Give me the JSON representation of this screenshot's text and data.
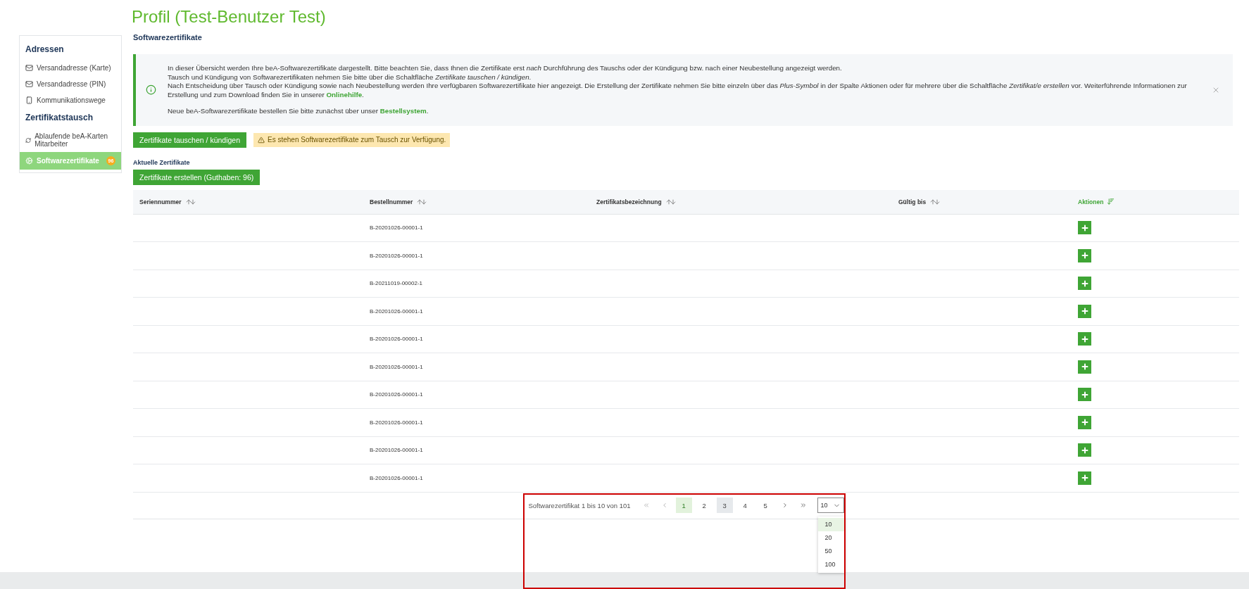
{
  "page_title": "Profil (Test-Benutzer Test)",
  "sidebar": {
    "sections": [
      {
        "heading": "Adressen",
        "items": [
          {
            "label": "Versandadresse (Karte)",
            "kind": "mail",
            "selected": false
          },
          {
            "label": "Versandadresse (PIN)",
            "kind": "mail",
            "selected": false
          },
          {
            "label": "Kommunikationswege",
            "kind": "phone",
            "selected": false
          }
        ]
      },
      {
        "heading": "Zertifikatstausch",
        "items": [
          {
            "label": "Ablaufende beA-Karten Mitarbeiter",
            "kind": "sync",
            "selected": false
          },
          {
            "label": "Softwarezertifikate",
            "kind": "gear",
            "selected": true,
            "badge": "96"
          }
        ]
      }
    ]
  },
  "section_title": "Softwarezertifikate",
  "info": {
    "blocks": [
      [
        {
          "text": "In dieser Übersicht werden Ihre beA-Softwarezertifikate dargestellt. Bitte beachten Sie, dass Ihnen die Zertifikate erst *nach* Durchführung des Tauschs oder der Kündigung bzw. nach einer Neubestellung angezeigt werden."
        },
        {
          "text": "Tausch und Kündigung von Softwarezertifikaten nehmen Sie bitte über die Schaltfläche *Zertifikate tauschen / kündigen*."
        },
        {
          "text": "Nach Entscheidung über Tausch oder Kündigung sowie nach Neubestellung werden Ihre verfügbaren Softwarezertifikate hier angezeigt. Die Erstellung der Zertifikate nehmen Sie bitte einzeln über das *Plus-Symbol* in der Spalte Aktionen oder für mehrere über die Schaltfläche *Zertifikat/e erstellen* vor. Weiterführende Informationen zur Erstellung und zum Download finden Sie in unserer",
          "link": "Onlinehilfe",
          "tail": "."
        }
      ],
      [
        {
          "text": "Neue beA-Softwarezertifikate bestellen Sie bitte zunächst über unser",
          "link": "Bestellsystem",
          "tail": "."
        }
      ]
    ]
  },
  "exchange_button": "Zertifikate tauschen / kündigen",
  "warning": "Es stehen Softwarezertifikate zum Tausch zur Verfügung.",
  "table_title": "Aktuelle Zertifikate",
  "create_button": "Zertifikate erstellen (Guthaben: 96)",
  "table": {
    "columns": [
      {
        "label": "Seriennummer",
        "active": false
      },
      {
        "label": "Bestellnummer",
        "active": false
      },
      {
        "label": "Zertifikatsbezeichnung",
        "active": false
      },
      {
        "label": "Gültig bis",
        "active": false
      },
      {
        "label": "Aktionen",
        "active": true
      }
    ],
    "rows": [
      {
        "order": "B-20201026-00001-1"
      },
      {
        "order": "B-20201026-00001-1"
      },
      {
        "order": "B-20211019-00002-1"
      },
      {
        "order": "B-20201026-00001-1"
      },
      {
        "order": "B-20201026-00001-1"
      },
      {
        "order": "B-20201026-00001-1"
      },
      {
        "order": "B-20201026-00001-1"
      },
      {
        "order": "B-20201026-00001-1"
      },
      {
        "order": "B-20201026-00001-1"
      },
      {
        "order": "B-20201026-00001-1"
      }
    ]
  },
  "pagination": {
    "summary": "Softwarezertifikat 1 bis 10 von 101",
    "pages": [
      {
        "label": "1",
        "selected": true,
        "hovered": false
      },
      {
        "label": "2",
        "selected": false,
        "hovered": false
      },
      {
        "label": "3",
        "selected": false,
        "hovered": true
      },
      {
        "label": "4",
        "selected": false,
        "hovered": false
      },
      {
        "label": "5",
        "selected": false,
        "hovered": false
      }
    ],
    "page_size": {
      "value": "10",
      "expanded": true,
      "options": [
        {
          "label": "10",
          "selected": true
        },
        {
          "label": "20",
          "selected": false
        },
        {
          "label": "50",
          "selected": false
        },
        {
          "label": "100",
          "selected": false
        }
      ]
    }
  },
  "annotation": {
    "kind": "highlight"
  }
}
